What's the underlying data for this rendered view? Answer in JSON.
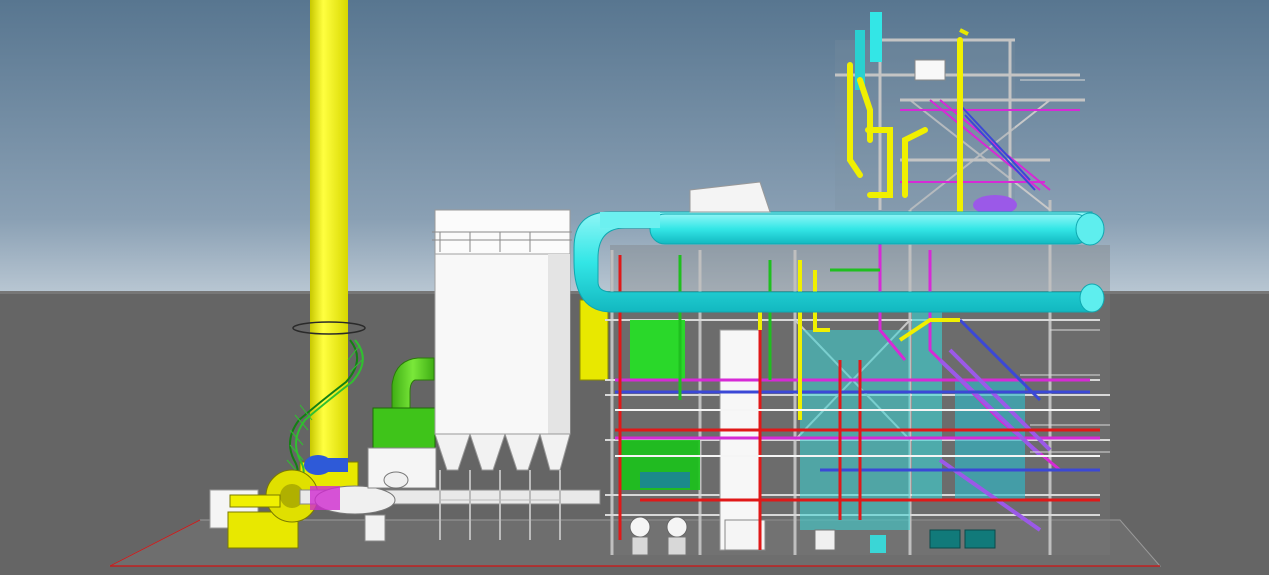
{
  "scene": {
    "colors": {
      "sky_top": "#587690",
      "sky_horizon": "#b8c6d2",
      "ground": "#646464",
      "ground_far": "#6d6d6d",
      "stack": "#f2f200",
      "cyan_duct": "#33e6e6",
      "cyan_edge": "#0fa8b0",
      "green_duct": "#52d11f",
      "white_building": "#f6f6f6",
      "steel_grey": "#a8a8a8",
      "magenta": "#d62ad6",
      "blue": "#3b48d6",
      "red": "#e01818",
      "violet": "#9b59e8"
    },
    "components": [
      "chimney-stack",
      "spiral-stair",
      "induced-draft-fan",
      "green-cyclone-duct",
      "bag-filter-house",
      "cyan-flue-duct",
      "boiler-steel-structure",
      "upper-tower",
      "pumps",
      "foundation-slab"
    ]
  }
}
